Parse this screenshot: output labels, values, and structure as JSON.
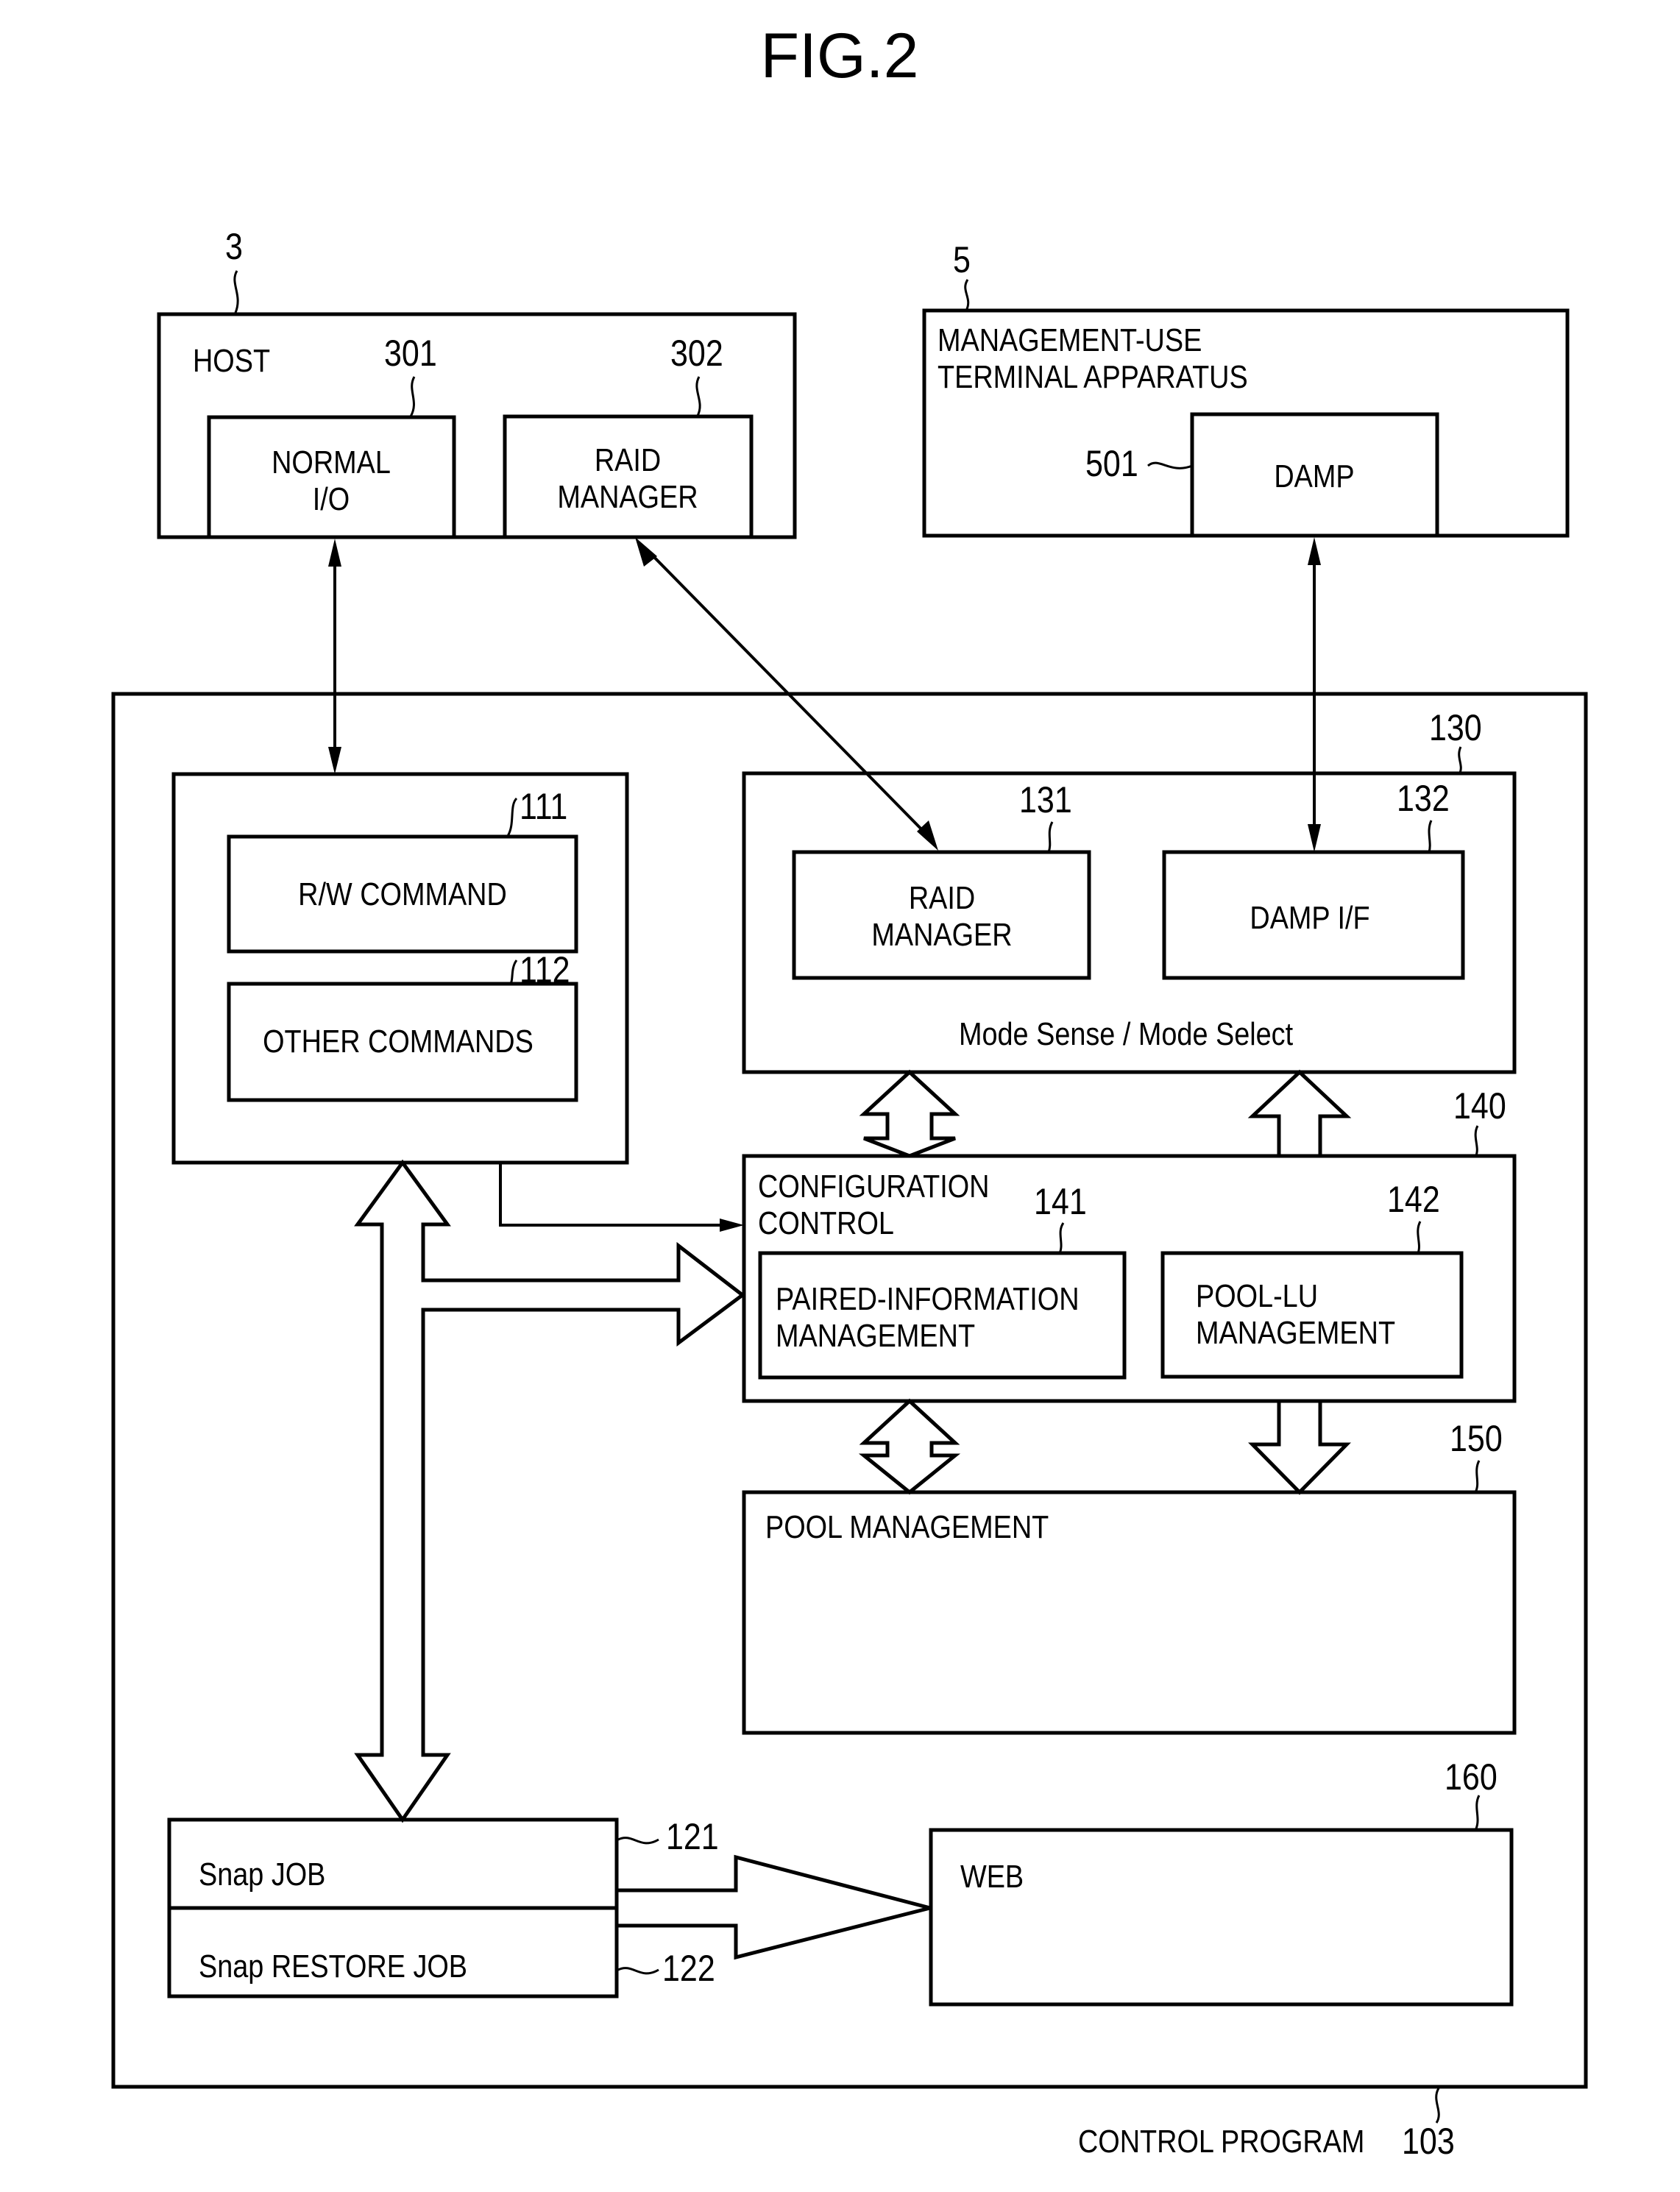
{
  "figure_title": "FIG.2",
  "host": {
    "ref": "3",
    "label": "HOST",
    "normal_io": {
      "ref": "301",
      "lines": [
        "NORMAL",
        "I/O"
      ]
    },
    "raid_manager": {
      "ref": "302",
      "lines": [
        "RAID",
        "MANAGER"
      ]
    }
  },
  "terminal": {
    "ref": "5",
    "lines": [
      "MANAGEMENT-USE",
      "TERMINAL APPARATUS"
    ],
    "damp": {
      "ref": "501",
      "label": "DAMP"
    }
  },
  "control_program": {
    "label": "CONTROL PROGRAM",
    "ref": "103",
    "command_block": {
      "rw_command": {
        "ref": "111",
        "label": "R/W COMMAND"
      },
      "other_commands": {
        "ref": "112",
        "label": "OTHER COMMANDS"
      }
    },
    "interface_block": {
      "ref": "130",
      "raid_manager": {
        "ref": "131",
        "lines": [
          "RAID",
          "MANAGER"
        ]
      },
      "damp_if": {
        "ref": "132",
        "label": "DAMP I/F"
      },
      "caption": "Mode Sense / Mode Select"
    },
    "configuration_control": {
      "ref": "140",
      "lines": [
        "CONFIGURATION",
        "CONTROL"
      ],
      "paired_info": {
        "ref": "141",
        "lines": [
          "PAIRED-INFORMATION",
          "MANAGEMENT"
        ]
      },
      "pool_lu": {
        "ref": "142",
        "lines": [
          "POOL-LU",
          "MANAGEMENT"
        ]
      }
    },
    "pool_management": {
      "ref": "150",
      "label": "POOL MANAGEMENT"
    },
    "snap_jobs": {
      "snap_job": {
        "ref": "121",
        "label": "Snap JOB"
      },
      "snap_restore_job": {
        "ref": "122",
        "label": "Snap RESTORE JOB"
      }
    },
    "web": {
      "ref": "160",
      "label": "WEB"
    }
  }
}
